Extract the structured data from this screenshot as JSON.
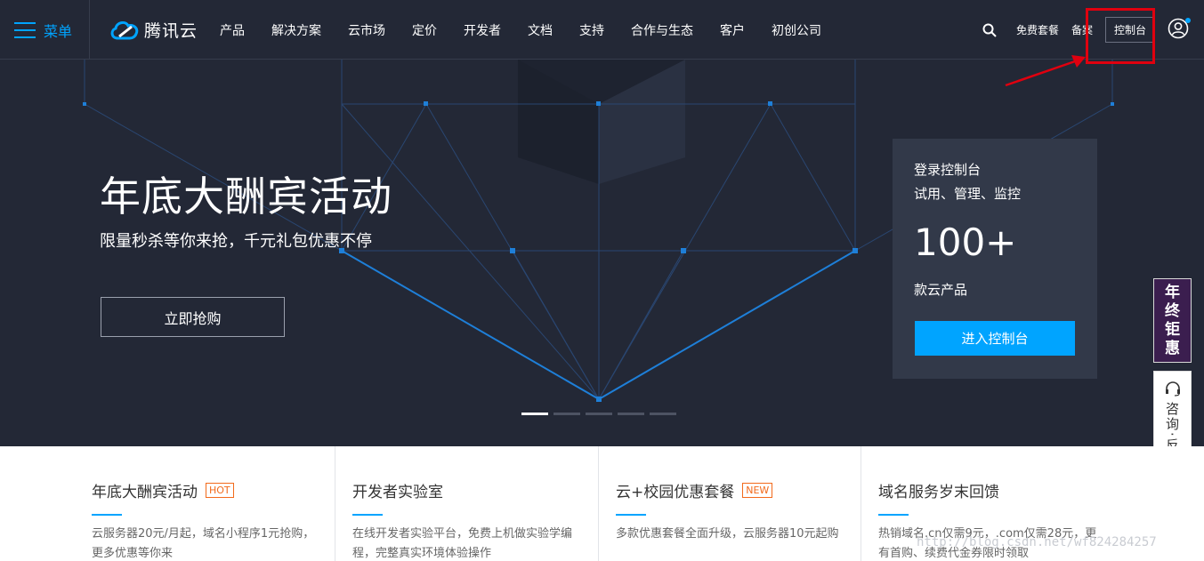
{
  "nav": {
    "menu_label": "菜单",
    "logo_text": "腾讯云",
    "items": [
      "产品",
      "解决方案",
      "云市场",
      "定价",
      "开发者",
      "文档",
      "支持",
      "合作与生态",
      "客户",
      "初创公司"
    ],
    "free_plan": "免费套餐",
    "record": "备案",
    "console": "控制台"
  },
  "hero": {
    "title": "年底大酬宾活动",
    "subtitle": "限量秒杀等你来抢，千元礼包优惠不停",
    "cta": "立即抢购",
    "slides_total": 5,
    "active_slide": 1
  },
  "console_card": {
    "line1": "登录控制台",
    "line2": "试用、管理、监控",
    "big_number": "100+",
    "line3": "款云产品",
    "button": "进入控制台"
  },
  "side": {
    "promo": [
      "年",
      "终",
      "钜",
      "惠"
    ],
    "consult": "咨询·反馈"
  },
  "cards": [
    {
      "title": "年底大酬宾活动",
      "badge": "HOT",
      "desc": "云服务器20元/月起，域名小程序1元抢购，更多优惠等你来"
    },
    {
      "title": "开发者实验室",
      "badge": "",
      "desc": "在线开发者实验平台，免费上机做实验学编程，完整真实环境体验操作"
    },
    {
      "title": "云+校园优惠套餐",
      "badge": "NEW",
      "desc": "多款优惠套餐全面升级，云服务器10元起购"
    },
    {
      "title": "域名服务岁末回馈",
      "badge": "",
      "desc": "热销域名.cn仅需9元，.com仅需28元，更有首购、续费代金券限时领取"
    }
  ],
  "watermark": "http://blog.csdn.net/wf824284257",
  "colors": {
    "accent": "#00a4ff",
    "nav_bg": "#232836",
    "highlight": "#e0000f",
    "badge": "#f26a1b"
  }
}
